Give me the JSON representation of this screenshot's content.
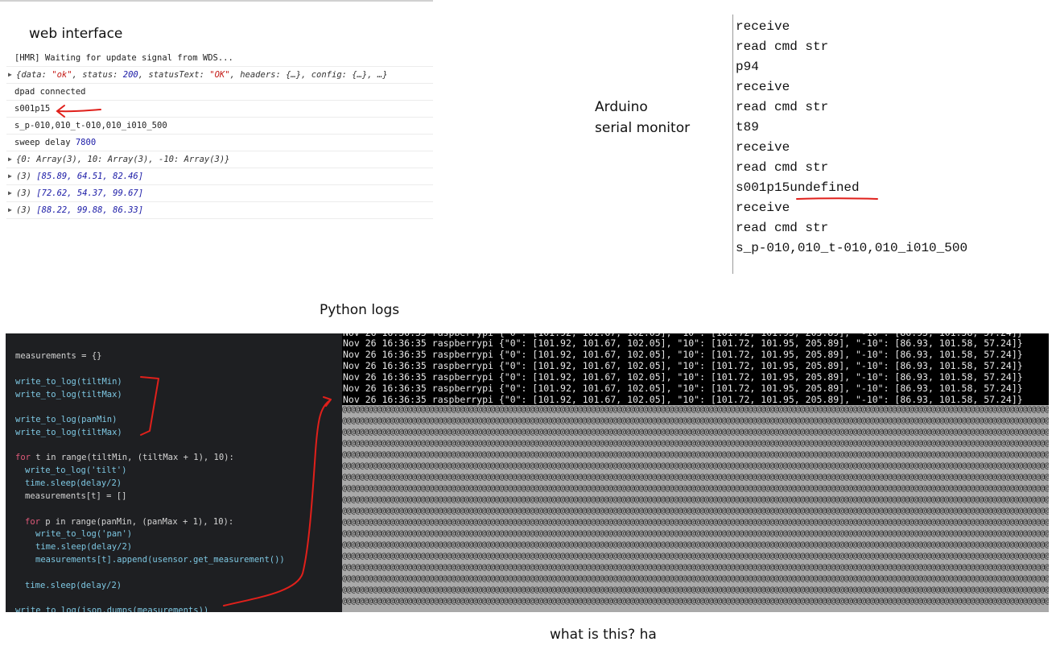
{
  "captions": {
    "web_interface": "web interface",
    "arduino_line1": "Arduino",
    "arduino_line2": "serial monitor",
    "python_logs": "Python logs",
    "question": "what is this? ha"
  },
  "console": {
    "rows": [
      "[HMR] Waiting for update signal from WDS...",
      "{data: \"ok\", status: 200, statusText: \"OK\", headers: {…}, config: {…}, …}",
      "dpad connected",
      "s001p15",
      "s_p-010,010_t-010,010_i010_500",
      "sweep delay 7800",
      "{0: Array(3), 10: Array(3), -10: Array(3)}",
      "(3) [85.89, 64.51, 82.46]",
      "(3) [72.62, 54.37, 99.67]",
      "(3) [88.22, 99.88, 86.33]"
    ],
    "parts": {
      "r2_open": "{data: ",
      "r2_ok": "\"ok\"",
      "r2_mid": ", status: ",
      "r2_200": "200",
      "r2_mid2": ", statusText: ",
      "r2_OK": "\"OK\"",
      "r2_end": ", headers: {…}, config: {…}, …}",
      "r6_label": "sweep delay ",
      "r6_val": "7800",
      "arr_prefix": "(3) ",
      "arr1": "[85.89, 64.51, 82.46]",
      "arr2": "[72.62, 54.37, 99.67]",
      "arr3": "[88.22, 99.88, 86.33]"
    }
  },
  "serial_monitor": {
    "lines": [
      "receive",
      "read cmd str",
      "p94",
      "receive",
      "read cmd str",
      "t89",
      "receive",
      "read cmd str",
      "s001p15",
      "receive",
      "read cmd str",
      "s_p-010,010_t-010,010_i010_500"
    ],
    "undefined_suffix": "undefined"
  },
  "code": {
    "measurements_init": "measurements = {}",
    "w_tiltMin": "write_to_log(tiltMin)",
    "w_tiltMax": "write_to_log(tiltMax)",
    "w_panMin": "write_to_log(panMin)",
    "w_tiltMax2": "write_to_log(tiltMax)",
    "for_t_kw": "for",
    "for_t_rest": " t in range(tiltMin, (tiltMax + 1), 10):",
    "write_tilt": "write_to_log('tilt')",
    "sleep1": "time.sleep(delay/2)",
    "meas_t": "measurements[t] = []",
    "for_p_kw": "for",
    "for_p_rest": " p in range(panMin, (panMax + 1), 10):",
    "write_pan": "write_to_log('pan')",
    "sleep2": "time.sleep(delay/2)",
    "append": "measurements[t].append(usensor.get_measurement())",
    "sleep3": "time.sleep(delay/2)",
    "last": "write_to_log(json.dumps(measurements))"
  },
  "terminal": {
    "log_line": "Nov 26 16:36:35 raspberrypi {\"0\": [101.92, 101.67, 102.05], \"10\": [101.72, 101.95, 205.89], \"-10\": [86.93, 101.58, 57.24]}",
    "garbage_line": "@@@@@@@@@@@@@@@@@@@@@@@@@@@@@@@@@@@@@@@@@@@@@@@@@@@@@@@@@@@@@@@@@@@@@@@@@@@@@@@@@@@@@@@@@@@@@@@@@@@@@@@@@@@@@@@@@@@@@@@@@@@@@@@@@@@@@@@@@@@@@@@@@@@@@@@@@@@@@@@@@@@@@@@@@@@@@@@@@@@"
  },
  "colors": {
    "annotation": "#e0201b",
    "editor_bg": "#1e1f22",
    "terminal_bg": "#000000",
    "garbage_bg": "#a9a9a9"
  }
}
